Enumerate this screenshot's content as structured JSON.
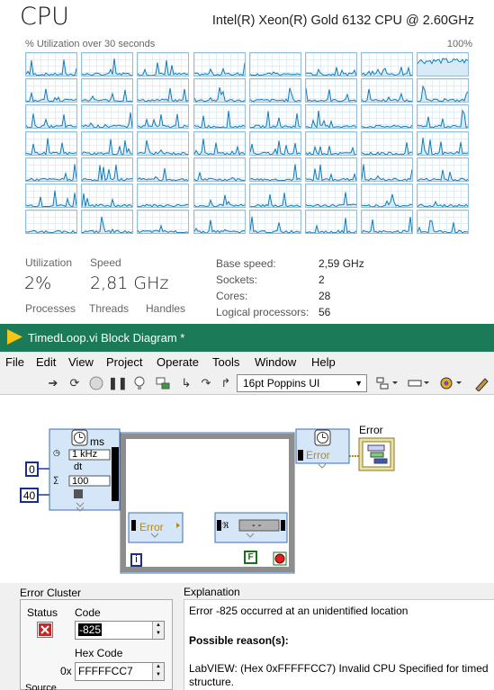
{
  "task_manager": {
    "title": "CPU",
    "cpu_model": "Intel(R) Xeon(R) Gold 6132 CPU @ 2.60GHz",
    "graph_subtitle": "% Utilization over 30 seconds",
    "graph_max": "100%",
    "stats": {
      "utilization_label": "Utilization",
      "utilization_value": "2%",
      "speed_label": "Speed",
      "speed_value": "2,81 GHz",
      "processes_label": "Processes",
      "threads_label": "Threads",
      "handles_label": "Handles"
    },
    "details": [
      {
        "label": "Base speed:",
        "value": "2,59 GHz"
      },
      {
        "label": "Sockets:",
        "value": "2"
      },
      {
        "label": "Cores:",
        "value": "28"
      },
      {
        "label": "Logical processors:",
        "value": "56"
      }
    ],
    "colors": {
      "graph_line": "#117dbb",
      "graph_border": "#93bedc"
    }
  },
  "labview": {
    "window_title": "TimedLoop.vi Block Diagram *",
    "menu": [
      "File",
      "Edit",
      "View",
      "Project",
      "Operate",
      "Tools",
      "Window",
      "Help"
    ],
    "font_select": "16pt Poppins UI",
    "diagram": {
      "ms_label": "ms",
      "freq_label": "1 kHz",
      "dt_label": "dt",
      "period_value": "100",
      "const_0": "0",
      "const_40": "40",
      "error_label_left": "Error",
      "error_label_right": "Error",
      "indicator_label": "Error",
      "iteration_terminal": "i",
      "stop_constant": "F",
      "dashes": "- -"
    },
    "error_panel": {
      "cluster_label": "Error Cluster",
      "status_label": "Status",
      "code_label": "Code",
      "code_value": "-825",
      "hex_label": "Hex Code",
      "hex_prefix": "0x",
      "hex_value": "FFFFFCC7",
      "source_label": "Source",
      "explanation_label": "Explanation",
      "line1": "Error -825 occurred at an unidentified location",
      "reason_heading": "Possible reason(s):",
      "line3": "LabVIEW: (Hex 0xFFFFFCC7) Invalid CPU Specified for timed",
      "line4": "structure."
    },
    "colors": {
      "title_bar": "#1b7a57",
      "wire_error": "#b58a1a",
      "node_fill": "#d4e6f7"
    }
  }
}
